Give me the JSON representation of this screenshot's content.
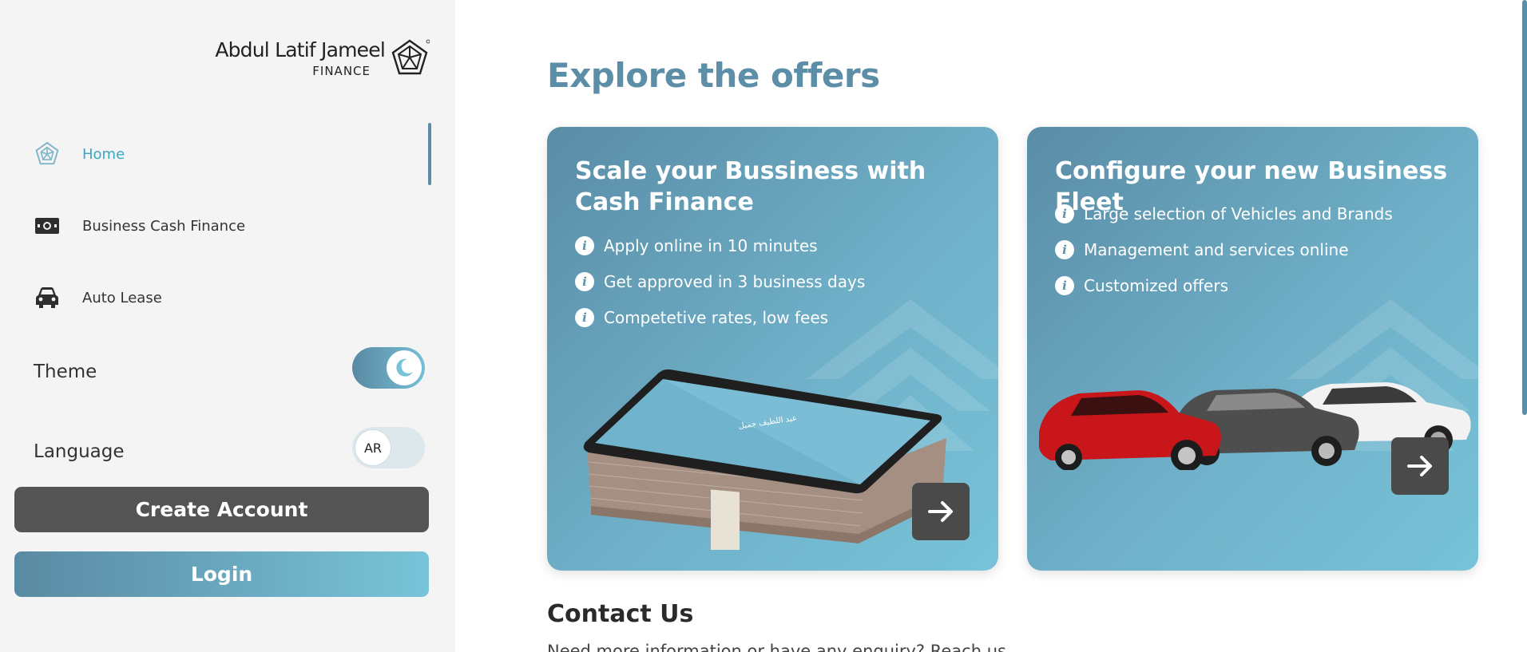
{
  "brand": {
    "name": "Abdul Latif Jameel",
    "sub": "FINANCE"
  },
  "sidebar": {
    "items": [
      {
        "label": "Home",
        "icon": "home-logo-icon",
        "active": true
      },
      {
        "label": "Business Cash Finance",
        "icon": "cash-icon",
        "active": false
      },
      {
        "label": "Auto Lease",
        "icon": "car-icon",
        "active": false
      }
    ],
    "theme_label": "Theme",
    "language_label": "Language",
    "language_value": "AR",
    "create_account_label": "Create Account",
    "login_label": "Login"
  },
  "main": {
    "title": "Explore the offers",
    "cards": [
      {
        "title": "Scale your Bussiness with Cash Finance",
        "bullets": [
          "Apply online in 10 minutes",
          "Get approved in 3 business days",
          "Competetive rates, low fees"
        ]
      },
      {
        "title": "Configure your new Business Fleet",
        "bullets": [
          "Large selection of Vehicles and Brands",
          "Management and services online",
          "Customized offers"
        ]
      }
    ],
    "contact_title": "Contact Us",
    "contact_text": "Need more information or have any enquiry? Reach us"
  },
  "colors": {
    "accent": "#5c8ea7",
    "accent_light": "#77c3d8",
    "active_nav": "#3ba7c4",
    "dark_button": "#545454"
  }
}
